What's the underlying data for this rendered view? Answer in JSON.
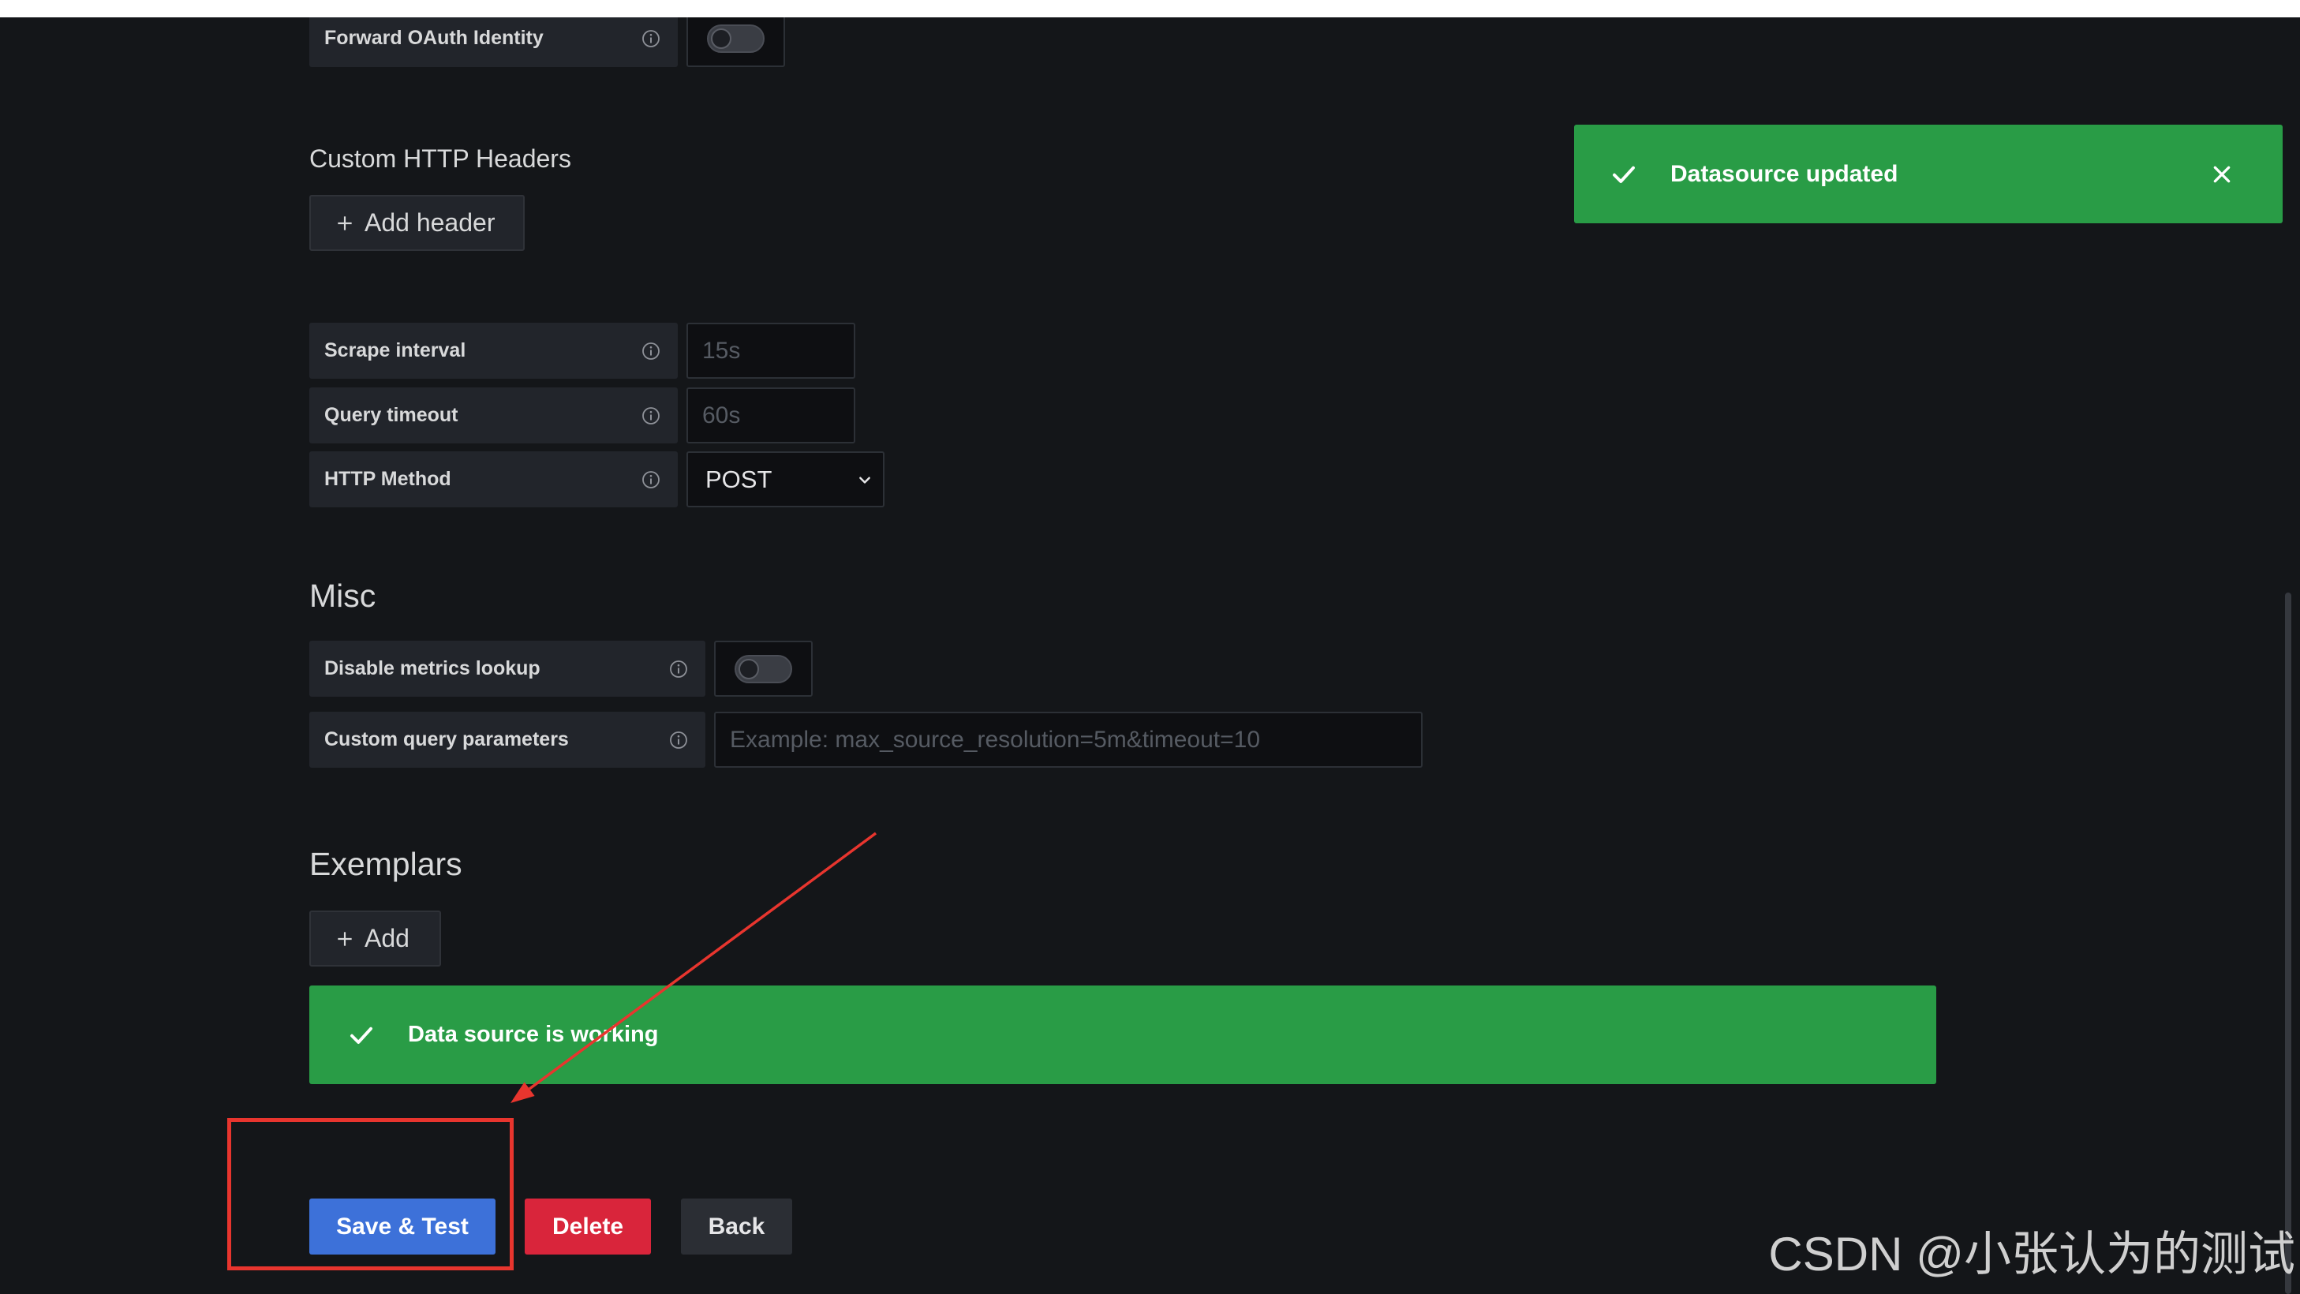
{
  "forward_oauth": {
    "label": "Forward OAuth Identity",
    "enabled": false
  },
  "custom_headers": {
    "heading": "Custom HTTP Headers",
    "add_label": "Add header"
  },
  "fields": {
    "scrape_interval": {
      "label": "Scrape interval",
      "placeholder": "15s",
      "value": ""
    },
    "query_timeout": {
      "label": "Query timeout",
      "placeholder": "60s",
      "value": ""
    },
    "http_method": {
      "label": "HTTP Method",
      "value": "POST"
    }
  },
  "misc": {
    "heading": "Misc",
    "disable_metrics_lookup": {
      "label": "Disable metrics lookup",
      "enabled": false
    },
    "custom_query_parameters": {
      "label": "Custom query parameters",
      "placeholder": "Example: max_source_resolution=5m&timeout=10",
      "value": ""
    }
  },
  "exemplars": {
    "heading": "Exemplars",
    "add_label": "Add"
  },
  "alert": {
    "text": "Data source is working"
  },
  "toast": {
    "text": "Datasource updated"
  },
  "actions": {
    "save_label": "Save & Test",
    "delete_label": "Delete",
    "back_label": "Back"
  },
  "watermark": "CSDN @小张认为的测试",
  "icons": {
    "info": "info-circle-icon",
    "success": "check-icon",
    "close": "close-icon",
    "add": "plus-icon",
    "dropdown": "chevron-down-icon"
  },
  "colors": {
    "page_bg": "#141619",
    "primary": "#3d71d9",
    "success": "#299c46",
    "danger": "#d9253b",
    "secondary": "#2b2e34",
    "annotation": "#e8352e"
  }
}
